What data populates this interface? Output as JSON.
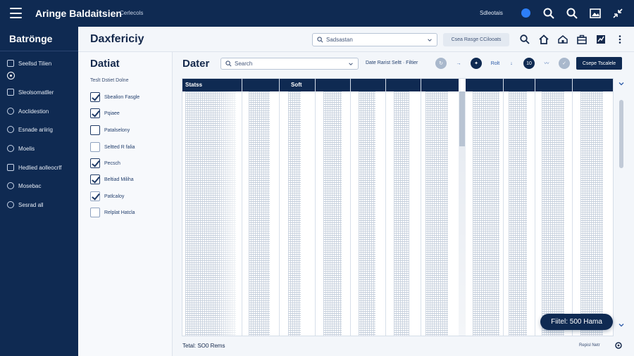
{
  "topbar": {
    "app_title": "Aringe Baldaitsien",
    "crumb": "Cerlecols",
    "status_text": "Sdleotais",
    "icons": [
      "menu-icon",
      "search-icon",
      "search-icon",
      "image-icon",
      "collapse-icon"
    ]
  },
  "sidebar": {
    "brand": "Batrönge",
    "items": [
      {
        "label": "Seellsd Tilien",
        "icon": "settings-icon"
      },
      {
        "label": "Sleolsomatller",
        "icon": "monitor-icon"
      },
      {
        "label": "Aoclidestion",
        "icon": "target-icon"
      },
      {
        "label": "Esnade ariirig",
        "icon": "link-icon"
      },
      {
        "label": "Moelis",
        "icon": "tools-icon"
      },
      {
        "label": "Hedlied aolleocrlf",
        "icon": "folder-icon"
      },
      {
        "label": "Mosebac",
        "icon": "clock-icon"
      },
      {
        "label": "Sesrad all",
        "icon": "globe-icon"
      }
    ]
  },
  "header": {
    "page_title": "Daxfericiy",
    "search_value": "Sadsastan",
    "range_label": "Csea Rasge  CCilooats"
  },
  "filters": {
    "title": "Datiat",
    "subtitle": "Teslt Dstiet Dolne",
    "items": [
      {
        "label": "Sbealion Fasgle",
        "checked": true
      },
      {
        "label": "Pqiaee",
        "checked": true
      },
      {
        "label": "Patalselony",
        "checked": false
      },
      {
        "label": "Seltted R falia",
        "checked": false
      },
      {
        "label": "Pecsch",
        "checked": true
      },
      {
        "label": "Beltiad Miliha",
        "checked": true
      },
      {
        "label": "Patlcaloy",
        "checked": true
      },
      {
        "label": "Relplat Hatcla",
        "checked": false
      }
    ]
  },
  "main": {
    "title": "Dater",
    "search_placeholder": "Search",
    "sort_label": "Date Rarist Seltt  ·  Filtier",
    "icons": {
      "refresh": "↻",
      "flow": "→",
      "nav": "✦",
      "edit": "Rolt",
      "down": "↓",
      "count": "10",
      "wave": "〰",
      "check": "✓"
    },
    "action_button": "Csepe Tscalele",
    "columns": [
      "Statss",
      "Soft"
    ],
    "status": "Tetal: SO0 Rems",
    "footer_right": "Repisl Netr"
  },
  "toast": "Fiitel: 500 Hama",
  "colors": {
    "navy": "#0f2a52",
    "accent": "#2d7ff9",
    "panel": "#f3f6fa"
  }
}
